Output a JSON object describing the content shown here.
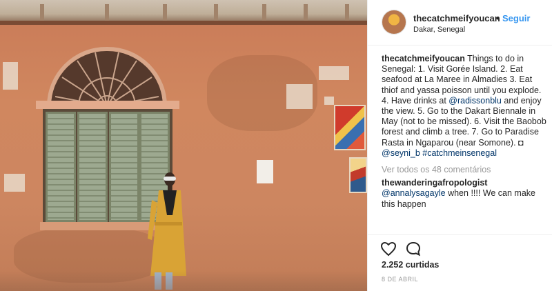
{
  "post": {
    "photo": {
      "alt": ""
    },
    "header": {
      "username": "thecatchmeifyoucan",
      "separator": "•",
      "follow_label": "Seguir",
      "location": "Dakar, Senegal"
    },
    "caption": {
      "username": "thecatchmeifyoucan",
      "text_1": " Things to do in Senegal: 1. Visit Gorée Island. 2. Eat seafood at La Maree in Almadies 3. Eat thiof and yassa poisson until you explode. 4. Have drinks at ",
      "mention_1": "@radissonblu",
      "text_2": " and enjoy the view. 5. Go to the Dakart Biennale in May (not to be missed). 6. Visit the Baobob forest and climb a tree. 7. Go to Paradise Rasta in Ngaparou (near Somone). ◘ ",
      "mention_2": "@seyni_b",
      "text_3": " ",
      "hashtag": "#catchmeinsenegal"
    },
    "view_all_label": "Ver todos os 48 comentários",
    "comment": {
      "username": "thewanderingafropologist",
      "mention": "@annalysagayle",
      "text": " when !!!! We can make this happen"
    },
    "icons": {
      "like": "heart-icon",
      "comment": "comment-bubble-icon"
    },
    "likes_label": "2.252 curtidas",
    "date_label": "8 DE ABRIL",
    "colors": {
      "link_blue": "#3897f0",
      "mention_navy": "#003569",
      "muted_gray": "#999999",
      "wall_orange": "#cd8660"
    }
  }
}
